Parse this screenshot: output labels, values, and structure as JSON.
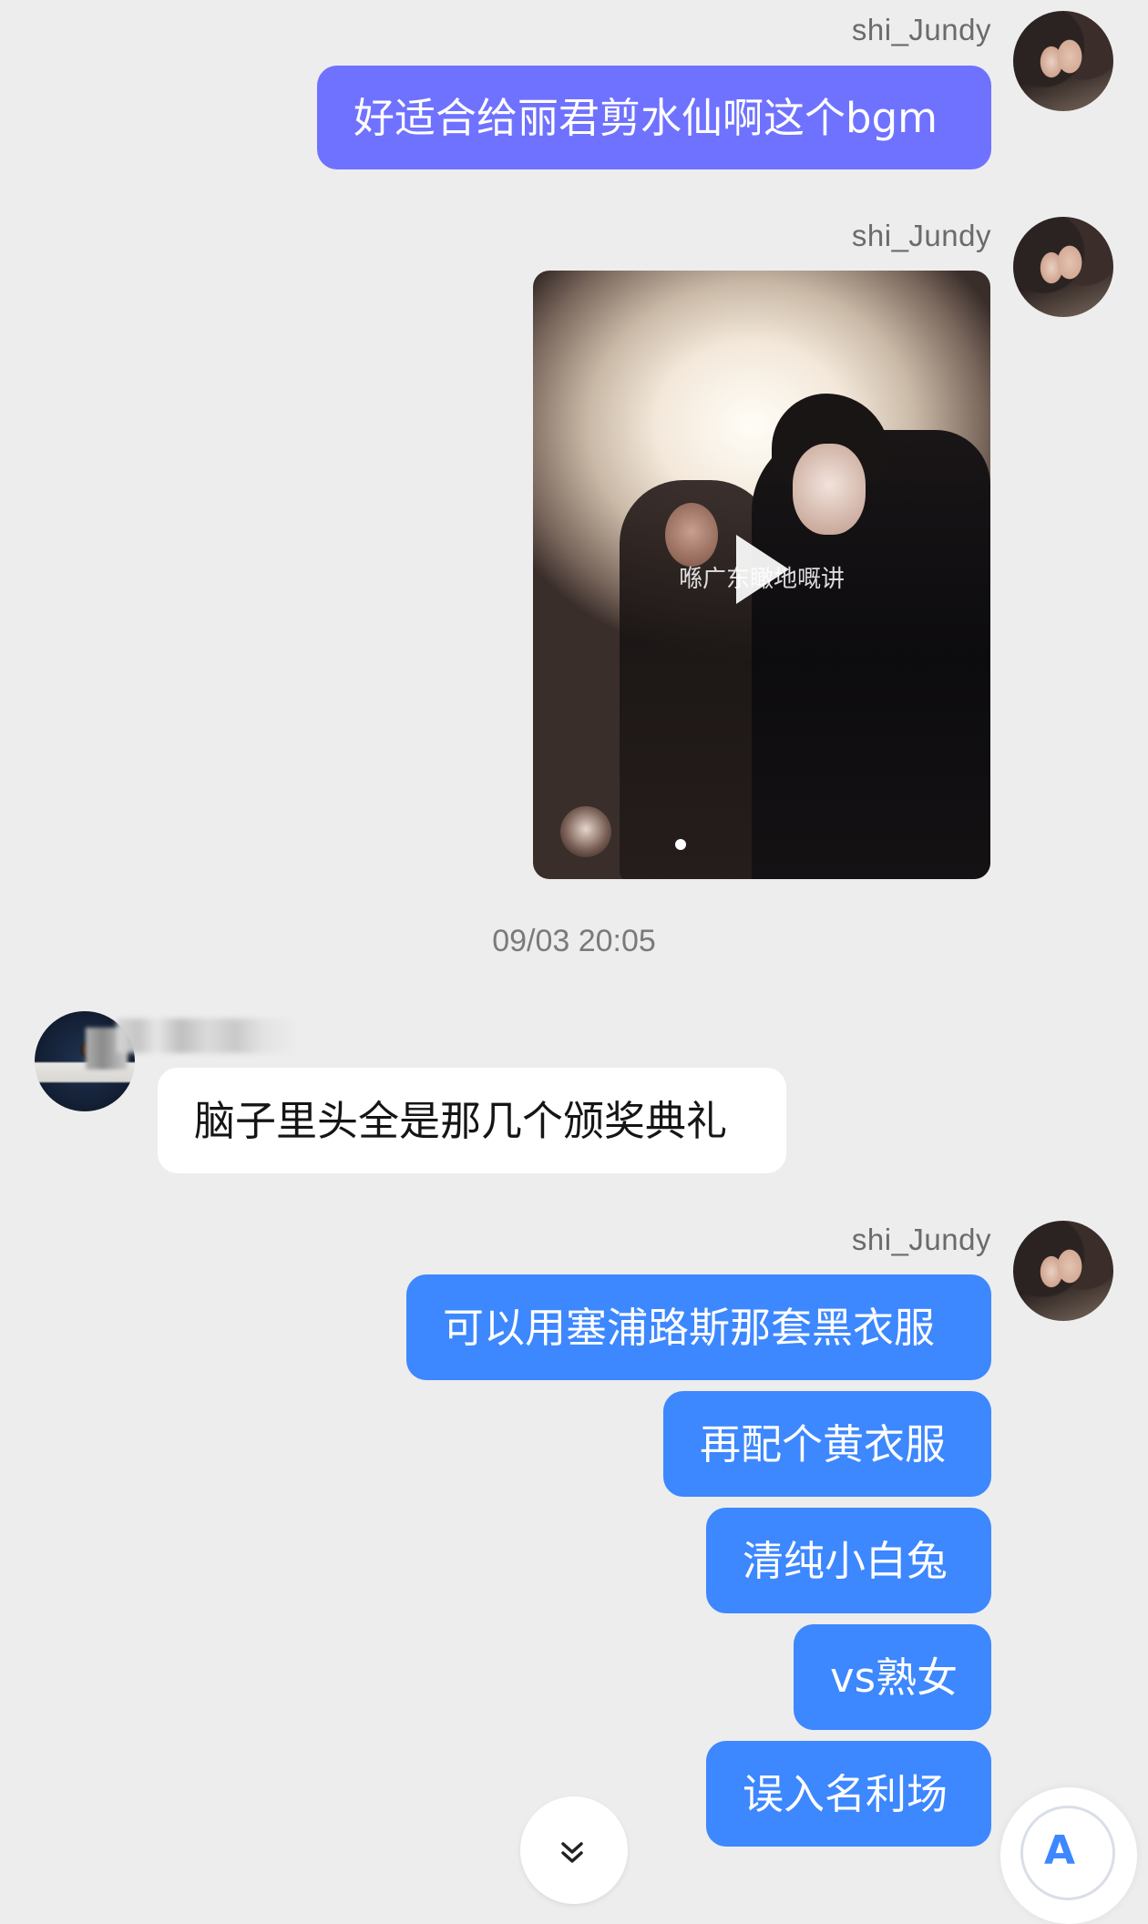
{
  "self_username": "shi_Jundy",
  "messages": [
    {
      "text": "好适合给丽君剪水仙啊这个bgm"
    },
    {
      "video_caption": "喺广东瞰地嘅讲"
    },
    {
      "timestamp": "09/03 20:05"
    },
    {
      "text": "脑子里头全是那几个颁奖典礼"
    },
    {
      "text": "可以用塞浦路斯那套黑衣服"
    },
    {
      "text": "再配个黄衣服"
    },
    {
      "text": "清纯小白兔"
    },
    {
      "text": "vs熟女"
    },
    {
      "text": "误入名利场"
    }
  ],
  "colors": {
    "bubble_purple": "#6f72ff",
    "bubble_blue": "#3d87ff",
    "bubble_white": "#ffffff",
    "background": "#ededed"
  },
  "icons": {
    "scroll_down": "double-chevron-down-icon",
    "translate": "text-recognition-icon"
  },
  "fab_glyph": "A"
}
